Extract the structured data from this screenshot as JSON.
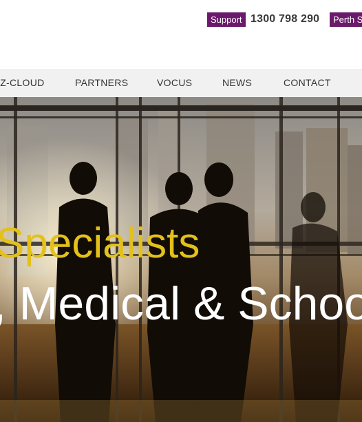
{
  "topbar": {
    "support_label": "Support",
    "phone": "1300 798 290",
    "location_label": "Perth Sa"
  },
  "nav": {
    "items": [
      {
        "label": "IZ-CLOUD"
      },
      {
        "label": "PARTNERS"
      },
      {
        "label": "VOCUS"
      },
      {
        "label": "NEWS"
      },
      {
        "label": "CONTACT"
      }
    ]
  },
  "hero": {
    "line1": "Specialists",
    "line2": ", Medical & Schoo",
    "colors": {
      "line1": "#e3c11a",
      "line2": "#ffffff"
    },
    "image_desc_icon": "business-people-photo"
  },
  "colors": {
    "brand_purple": "#6b1a6b",
    "nav_background": "#f1f1f1"
  }
}
